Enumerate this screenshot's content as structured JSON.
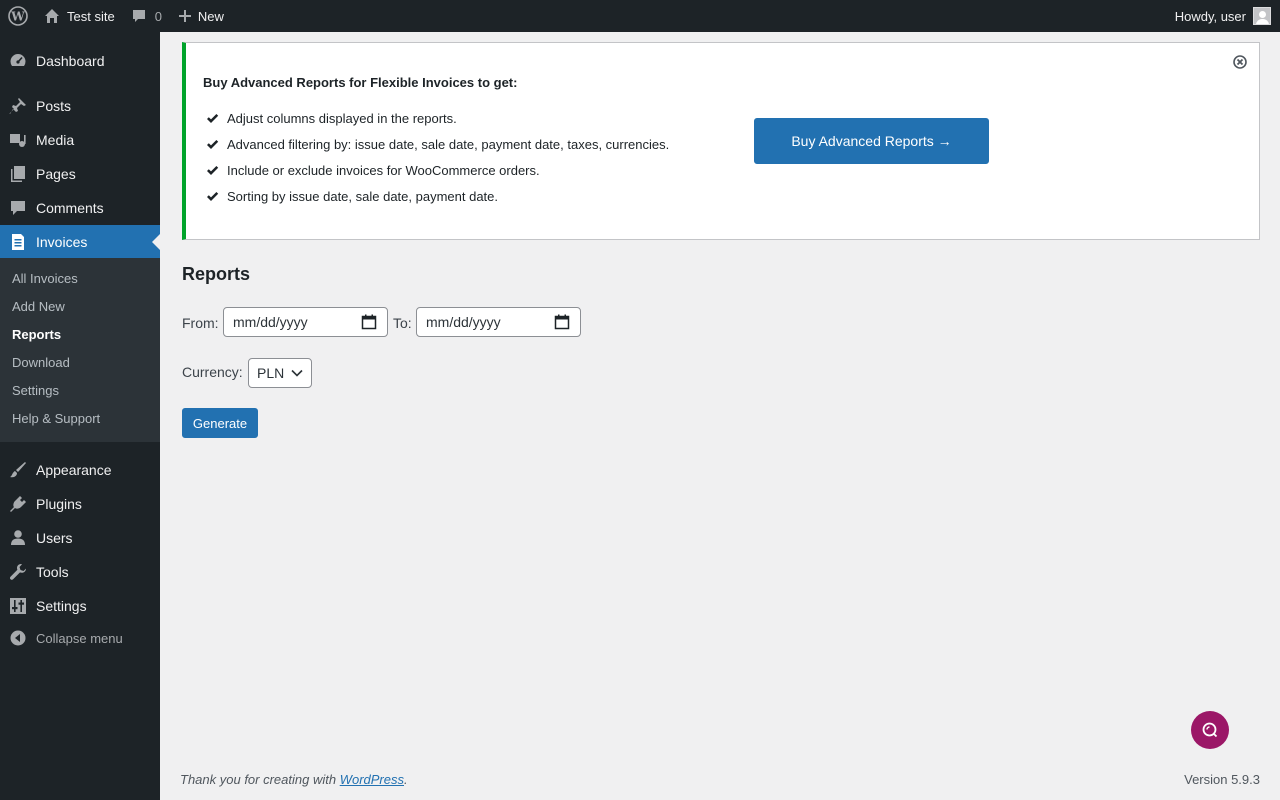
{
  "adminbar": {
    "site_name": "Test site",
    "comments_count": "0",
    "new_label": "New",
    "greeting": "Howdy, user"
  },
  "sidebar": {
    "items": [
      {
        "label": "Dashboard",
        "icon": "dashboard-icon"
      },
      {
        "label": "Posts",
        "icon": "pin-icon"
      },
      {
        "label": "Media",
        "icon": "media-icon"
      },
      {
        "label": "Pages",
        "icon": "pages-icon"
      },
      {
        "label": "Comments",
        "icon": "comment-icon"
      },
      {
        "label": "Invoices",
        "icon": "invoice-icon"
      },
      {
        "label": "Appearance",
        "icon": "brush-icon"
      },
      {
        "label": "Plugins",
        "icon": "plugin-icon"
      },
      {
        "label": "Users",
        "icon": "user-icon"
      },
      {
        "label": "Tools",
        "icon": "wrench-icon"
      },
      {
        "label": "Settings",
        "icon": "settings-icon"
      }
    ],
    "submenu": [
      "All Invoices",
      "Add New",
      "Reports",
      "Download",
      "Settings",
      "Help & Support"
    ],
    "collapse_label": "Collapse menu"
  },
  "notice": {
    "title": "Buy Advanced Reports for Flexible Invoices to get:",
    "items": [
      "Adjust columns displayed in the reports.",
      "Advanced filtering by: issue date, sale date, payment date, taxes, currencies.",
      "Include or exclude invoices for WooCommerce orders.",
      "Sorting by issue date, sale date, payment date."
    ],
    "button_label": "Buy Advanced Reports →"
  },
  "reports": {
    "title": "Reports",
    "from_label": "From:",
    "from_value": "mm/dd/yyyy",
    "to_label": "To:",
    "to_value": "mm/dd/yyyy",
    "currency_label": "Currency:",
    "currency_value": "PLN",
    "generate_label": "Generate"
  },
  "footer": {
    "thanks_prefix": "Thank you for creating with ",
    "wordpress_link": "WordPress",
    "thanks_suffix": ".",
    "version": "Version 5.9.3"
  },
  "colors": {
    "primary": "#2271b1",
    "notice_border": "#00a32a",
    "help_bubble": "#9b1767",
    "adminbar_bg": "#1d2327"
  }
}
